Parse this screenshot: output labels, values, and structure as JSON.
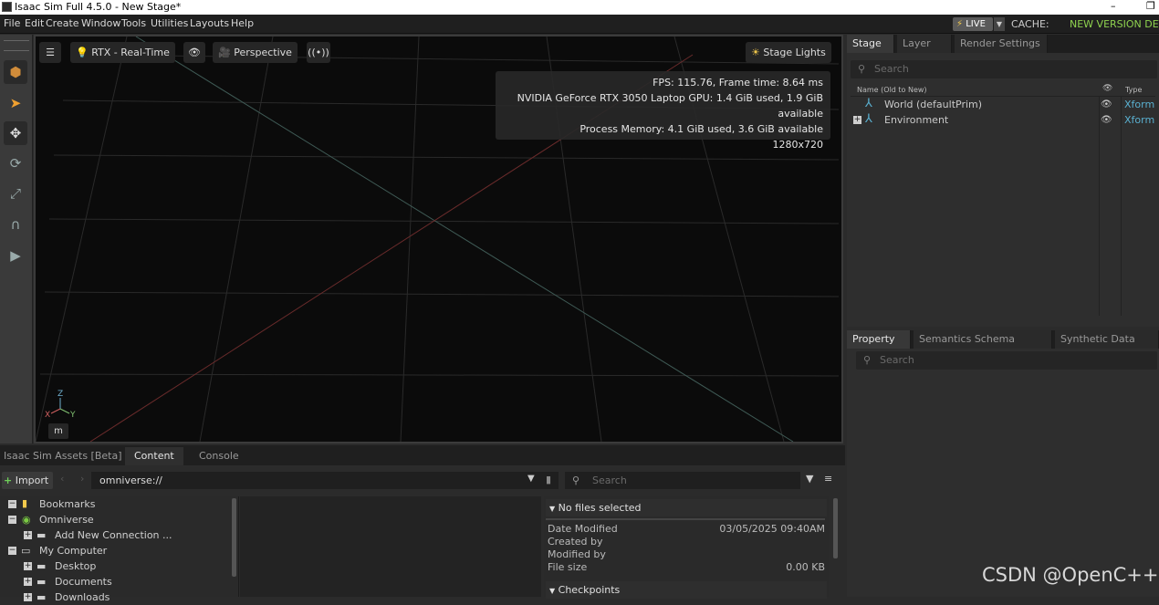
{
  "window": {
    "title": "Isaac Sim Full 4.5.0 - New Stage*",
    "minimize": "–",
    "restore": "❐"
  },
  "menu": {
    "items": [
      "File",
      "Edit",
      "Create",
      "Window",
      "Tools",
      "Utilities",
      "Layouts",
      "Help"
    ],
    "live_label": "LIVE",
    "cache_label": "CACHE:",
    "new_version": "NEW VERSION DETE"
  },
  "viewport": {
    "renderer": "RTX - Real-Time",
    "camera": "Perspective",
    "stage_lights": "Stage Lights",
    "stats": {
      "fps": "FPS: 115.76, Frame time: 8.64 ms",
      "gpu": "NVIDIA GeForce RTX 3050 Laptop GPU: 1.4 GiB used, 1.9 GiB available",
      "process_memory": "Process Memory: 4.1 GiB used, 3.6 GiB available",
      "resolution": "1280x720"
    },
    "axes": {
      "z": "Z",
      "x": "X",
      "y": "Y"
    },
    "unit_button": "m"
  },
  "stage_panel": {
    "tabs": [
      "Stage",
      "Layer",
      "Render Settings"
    ],
    "search_placeholder": "Search",
    "col_name": "Name (Old to New)",
    "col_type": "Type",
    "rows": [
      {
        "name": "World (defaultPrim)",
        "type": "Xform"
      },
      {
        "name": "Environment",
        "type": "Xform"
      }
    ]
  },
  "property_panel": {
    "tabs": [
      "Property",
      "Semantics Schema Editor",
      "Synthetic Data Recor"
    ],
    "search_placeholder": "Search"
  },
  "bottom_panel": {
    "tabs": [
      "Isaac Sim Assets [Beta]",
      "Content",
      "Console"
    ],
    "import_label": "Import",
    "path": "omniverse://",
    "search_placeholder": "Search",
    "tree": [
      {
        "label": "Bookmarks",
        "pm": "−"
      },
      {
        "label": "Omniverse",
        "pm": "−"
      },
      {
        "label": "Add New Connection ...",
        "pm": "+"
      },
      {
        "label": "My Computer",
        "pm": "−"
      },
      {
        "label": "Desktop",
        "pm": "+"
      },
      {
        "label": "Documents",
        "pm": "+"
      },
      {
        "label": "Downloads",
        "pm": "+"
      }
    ],
    "details": {
      "header": "No files selected",
      "date_modified_label": "Date Modified",
      "date_modified_value": "03/05/2025 09:40AM",
      "created_by_label": "Created by",
      "modified_by_label": "Modified by",
      "file_size_label": "File size",
      "file_size_value": "0.00 KB",
      "checkpoints": "Checkpoints"
    }
  },
  "watermark": "CSDN @OpenC++",
  "colors": {
    "accent_live": "#f2c94c",
    "new_version": "#8fd34f",
    "xform_icon": "#5ab0d0"
  }
}
